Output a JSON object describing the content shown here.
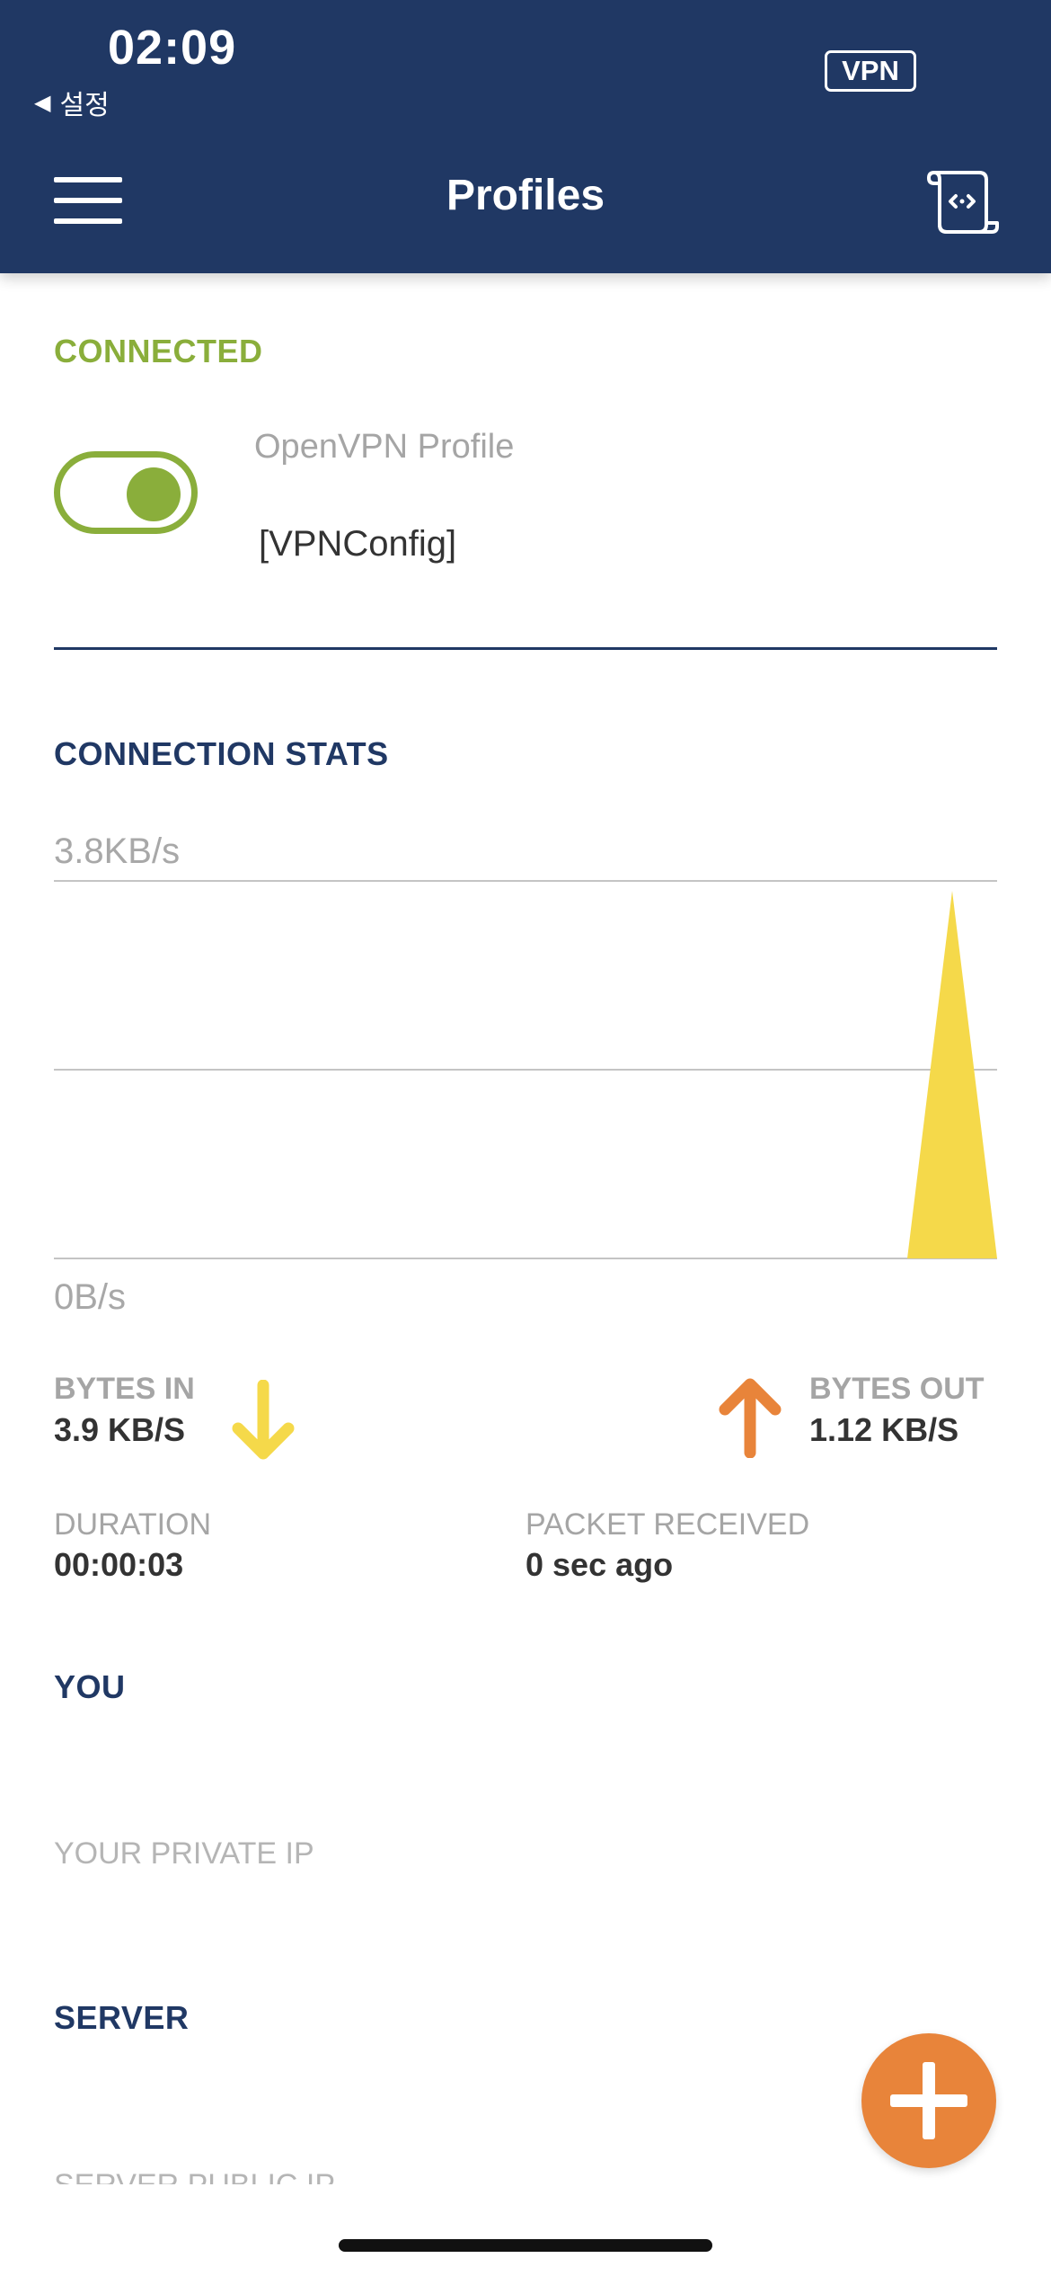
{
  "status_bar": {
    "time": "02:09",
    "back_label": "설정",
    "vpn_badge": "VPN"
  },
  "header": {
    "title": "Profiles",
    "menu_icon": "hamburger-menu-icon",
    "right_icon": "import-profile-icon"
  },
  "profile": {
    "state_label": "CONNECTED",
    "type": "OpenVPN Profile",
    "name": "[VPNConfig]",
    "toggle_on": true
  },
  "stats": {
    "section_label": "CONNECTION STATS",
    "bytes_in_label": "BYTES IN",
    "bytes_in_value": "3.9 KB/S",
    "bytes_out_label": "BYTES OUT",
    "bytes_out_value": "1.12 KB/S",
    "duration_label": "DURATION",
    "duration_value": "00:00:03",
    "packet_label": "PACKET RECEIVED",
    "packet_value": "0 sec ago"
  },
  "chart_data": {
    "type": "area",
    "ylim_labels": [
      "0B/s",
      "3.8KB/s"
    ],
    "ylim": [
      0,
      3.8
    ],
    "series": [
      {
        "values": [
          0,
          0,
          0,
          0,
          0,
          0,
          0,
          0,
          0,
          0,
          0,
          0,
          0,
          0,
          0,
          0,
          0,
          0,
          0,
          0,
          3.7,
          0
        ]
      }
    ],
    "grid": true,
    "colors": {
      "in": "#f5d94a"
    }
  },
  "you": {
    "section_label": "YOU",
    "private_ip_label": "YOUR PRIVATE IP"
  },
  "server": {
    "section_label": "SERVER",
    "public_ip_label": "SERVER PUBLIC IP"
  },
  "fab": {
    "icon": "plus-icon"
  },
  "colors": {
    "header_bg": "#203864",
    "connected": "#8aae3b",
    "accent_orange": "#e8843a",
    "accent_yellow": "#f5d94a"
  }
}
